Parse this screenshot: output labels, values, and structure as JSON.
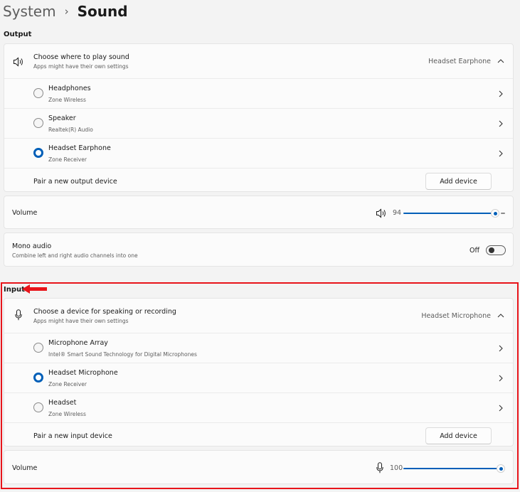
{
  "breadcrumb": {
    "parent": "System",
    "separator": "›",
    "current": "Sound"
  },
  "output": {
    "section_label": "Output",
    "chooser": {
      "title": "Choose where to play sound",
      "subtitle": "Apps might have their own settings",
      "value": "Headset Earphone"
    },
    "devices": [
      {
        "name": "Headphones",
        "subtitle": "Zone Wireless",
        "selected": false
      },
      {
        "name": "Speaker",
        "subtitle": "Realtek(R) Audio",
        "selected": false
      },
      {
        "name": "Headset Earphone",
        "subtitle": "Zone Receiver",
        "selected": true
      }
    ],
    "pair": {
      "label": "Pair a new output device",
      "button": "Add device"
    },
    "volume": {
      "label": "Volume",
      "value": 94
    },
    "mono": {
      "title": "Mono audio",
      "subtitle": "Combine left and right audio channels into one",
      "state": "Off"
    }
  },
  "input": {
    "section_label": "Input",
    "chooser": {
      "title": "Choose a device for speaking or recording",
      "subtitle": "Apps might have their own settings",
      "value": "Headset Microphone"
    },
    "devices": [
      {
        "name": "Microphone Array",
        "subtitle": "Intel® Smart Sound Technology for Digital Microphones",
        "selected": false
      },
      {
        "name": "Headset Microphone",
        "subtitle": "Zone Receiver",
        "selected": true
      },
      {
        "name": "Headset",
        "subtitle": "Zone Wireless",
        "selected": false
      }
    ],
    "pair": {
      "label": "Pair a new input device",
      "button": "Add device"
    },
    "volume": {
      "label": "Volume",
      "value": 100
    }
  },
  "colors": {
    "accent": "#005fb8",
    "annotation": "#e8141a"
  },
  "icons": {
    "speaker": "speaker-icon",
    "microphone": "microphone-icon",
    "chevron_right": "chevron-right-icon",
    "chevron_up": "chevron-up-icon",
    "arrow": "red-arrow-icon"
  }
}
